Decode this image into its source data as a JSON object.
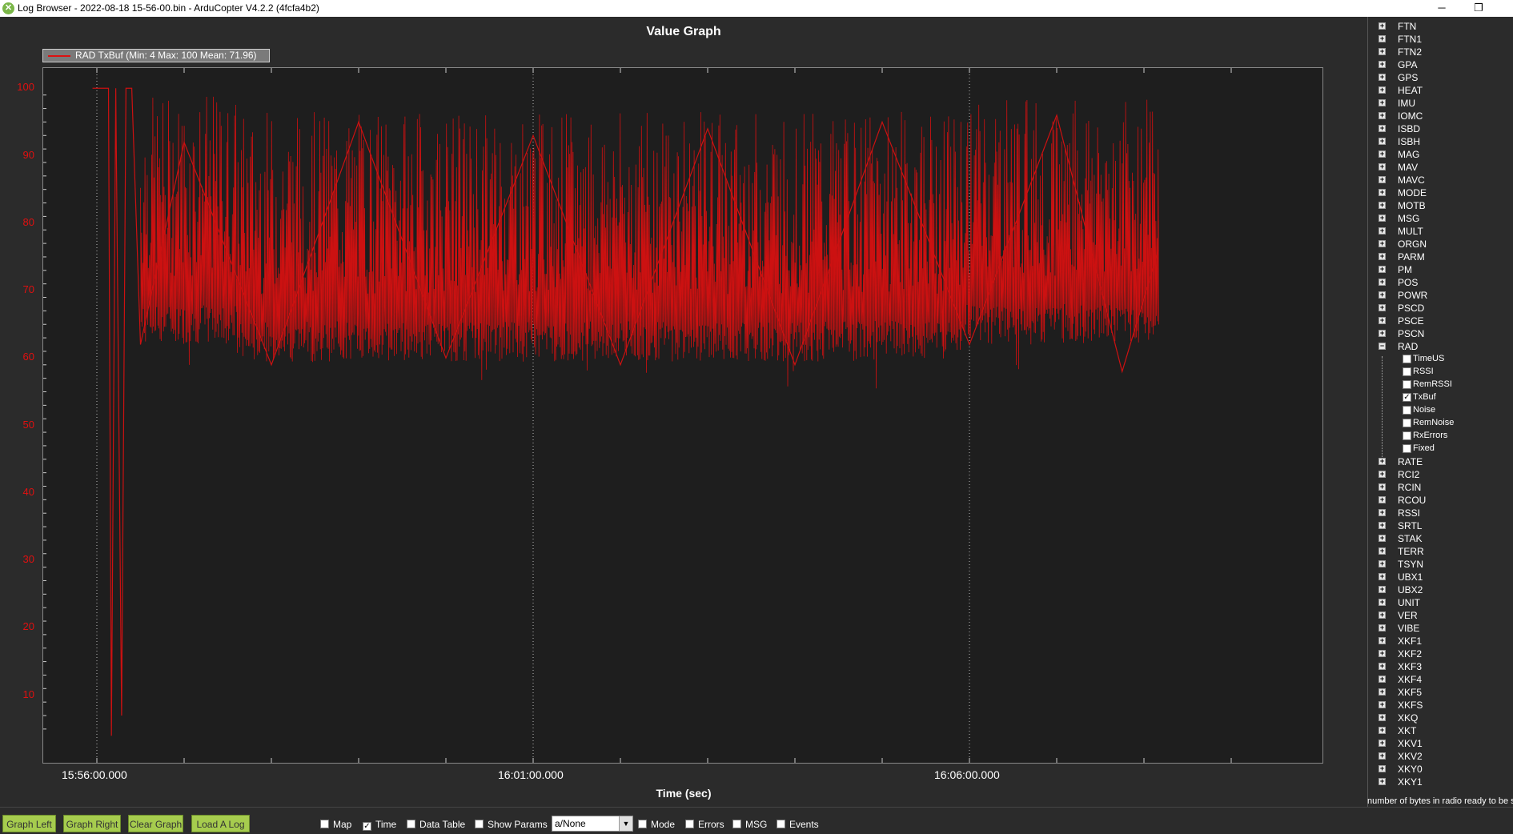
{
  "window": {
    "title": "Log Browser - 2022-08-18 15-56-00.bin - ArduCopter V4.2.2 (4fcfa4b2)",
    "minimize": "─",
    "restore": "❐"
  },
  "graph": {
    "title": "Value Graph",
    "legend": "RAD TxBuf  (Min: 4 Max: 100 Mean: 71.96)",
    "series_color": "#cc1111"
  },
  "chart_data": {
    "type": "line",
    "title": "Value Graph",
    "xlabel": "Time (sec)",
    "ylabel": "",
    "ylim": [
      0,
      103
    ],
    "x_tick_labels": [
      "15:56:00.000",
      "16:01:00.000",
      "16:06:00.000"
    ],
    "y_ticks": [
      10,
      20,
      30,
      40,
      50,
      60,
      70,
      80,
      90,
      100
    ],
    "grid": "vertical dotted at major x ticks",
    "series": [
      {
        "name": "RAD TxBuf",
        "color": "#cc1111",
        "min": 4,
        "max": 100,
        "mean": 71.96,
        "x": [
          "15:55:57",
          "15:56:08",
          "15:56:10",
          "15:56:13",
          "15:56:17",
          "15:56:20",
          "15:56:24",
          "15:56:30",
          "15:57:00",
          "15:58:00",
          "15:59:00",
          "16:00:00",
          "16:01:00",
          "16:02:00",
          "16:03:00",
          "16:04:00",
          "16:05:00",
          "16:06:00",
          "16:07:00",
          "16:07:45",
          "16:08:10"
        ],
        "y": [
          100,
          100,
          4,
          100,
          7,
          100,
          100,
          62,
          92,
          59,
          95,
          60,
          93,
          59,
          94,
          59,
          95,
          62,
          96,
          58,
          76
        ]
      }
    ]
  },
  "sidebar": {
    "items_top": [
      "FTN",
      "FTN1",
      "FTN2",
      "GPA",
      "GPS",
      "HEAT",
      "IMU",
      "IOMC",
      "ISBD",
      "ISBH",
      "MAG",
      "MAV",
      "MAVC",
      "MODE",
      "MOTB",
      "MSG",
      "MULT",
      "ORGN",
      "PARM",
      "PM",
      "POS",
      "POWR",
      "PSCD",
      "PSCE",
      "PSCN"
    ],
    "expanded": "RAD",
    "children": [
      {
        "label": "TimeUS",
        "checked": false
      },
      {
        "label": "RSSI",
        "checked": false
      },
      {
        "label": "RemRSSI",
        "checked": false
      },
      {
        "label": "TxBuf",
        "checked": true
      },
      {
        "label": "Noise",
        "checked": false
      },
      {
        "label": "RemNoise",
        "checked": false
      },
      {
        "label": "RxErrors",
        "checked": false
      },
      {
        "label": "Fixed",
        "checked": false
      }
    ],
    "items_bottom": [
      "RATE",
      "RCI2",
      "RCIN",
      "RCOU",
      "RSSI",
      "SRTL",
      "STAK",
      "TERR",
      "TSYN",
      "UBX1",
      "UBX2",
      "UNIT",
      "VER",
      "VIBE",
      "XKF1",
      "XKF2",
      "XKF3",
      "XKF4",
      "XKF5",
      "XKFS",
      "XKQ",
      "XKT",
      "XKV1",
      "XKV2",
      "XKY0",
      "XKY1"
    ],
    "status": "number of bytes in radio ready to be sent"
  },
  "toolbar": {
    "graph_left": "Graph Left",
    "graph_right": "Graph Right",
    "clear_graph": "Clear Graph",
    "load_log": "Load A Log",
    "map": "Map",
    "time": "Time",
    "data_table": "Data Table",
    "show_params": "Show Params",
    "combo_value": "a/None",
    "mode": "Mode",
    "errors": "Errors",
    "msg": "MSG",
    "events": "Events",
    "checked": {
      "map": false,
      "time": true,
      "data_table": false,
      "show_params": false,
      "mode": false,
      "errors": false,
      "msg": false,
      "events": false
    }
  }
}
